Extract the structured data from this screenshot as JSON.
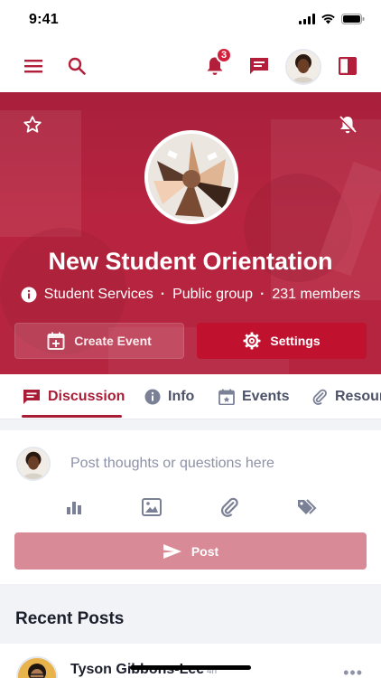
{
  "status_bar": {
    "time": "9:41"
  },
  "header": {
    "notification_count": "3"
  },
  "group": {
    "name": "New Student Orientation",
    "department": "Student Services",
    "visibility": "Public group",
    "members": "231 members"
  },
  "actions": {
    "create_event": "Create Event",
    "settings": "Settings"
  },
  "tabs": [
    {
      "label": "Discussion",
      "active": true
    },
    {
      "label": "Info"
    },
    {
      "label": "Events"
    },
    {
      "label": "Resources"
    }
  ],
  "composer": {
    "placeholder": "Post thoughts or questions here",
    "post_label": "Post"
  },
  "recent": {
    "title": "Recent Posts",
    "first_post": {
      "author": "Tyson Gibbons-Lee",
      "time": "4h"
    }
  },
  "colors": {
    "brand": "#a81c36",
    "hero": "#b8243f",
    "post_button": "#d98a97"
  }
}
